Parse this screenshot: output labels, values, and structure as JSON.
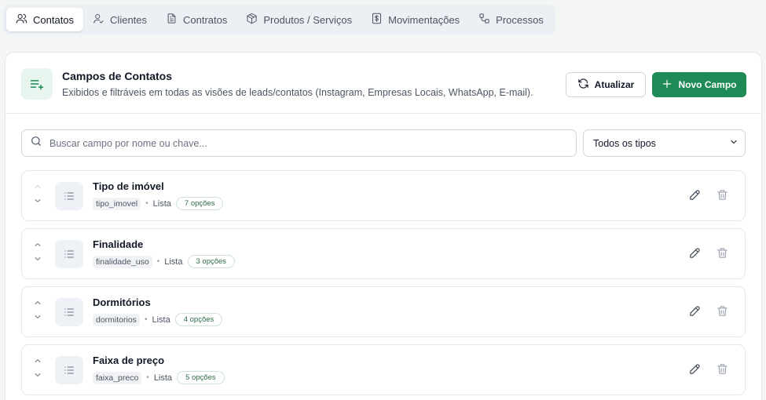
{
  "tabs": [
    {
      "label": "Contatos",
      "icon": "users-icon",
      "active": true
    },
    {
      "label": "Clientes",
      "icon": "user-check-icon",
      "active": false
    },
    {
      "label": "Contratos",
      "icon": "file-text-icon",
      "active": false
    },
    {
      "label": "Produtos / Serviços",
      "icon": "package-icon",
      "active": false
    },
    {
      "label": "Movimentações",
      "icon": "receipt-icon",
      "active": false
    },
    {
      "label": "Processos",
      "icon": "workflow-icon",
      "active": false
    }
  ],
  "header": {
    "title": "Campos de Contatos",
    "subtitle": "Exibidos e filtráveis em todas as visões de leads/contatos (Instagram, Empresas Locais, WhatsApp, E-mail).",
    "refresh_label": "Atualizar",
    "new_label": "Novo Campo"
  },
  "filters": {
    "search_placeholder": "Buscar campo por nome ou chave...",
    "type_selected": "Todos os tipos"
  },
  "fields": [
    {
      "name": "Tipo de imóvel",
      "key": "tipo_imovel",
      "type": "Lista",
      "options": "7 opções"
    },
    {
      "name": "Finalidade",
      "key": "finalidade_uso",
      "type": "Lista",
      "options": "3 opções"
    },
    {
      "name": "Dormitórios",
      "key": "dormitorios",
      "type": "Lista",
      "options": "4 opções"
    },
    {
      "name": "Faixa de preço",
      "key": "faixa_preco",
      "type": "Lista",
      "options": "5 opções"
    }
  ],
  "colors": {
    "accent": "#1e8a55",
    "accent_bg": "#e8f4ee",
    "badge_text": "#2f6b47"
  }
}
